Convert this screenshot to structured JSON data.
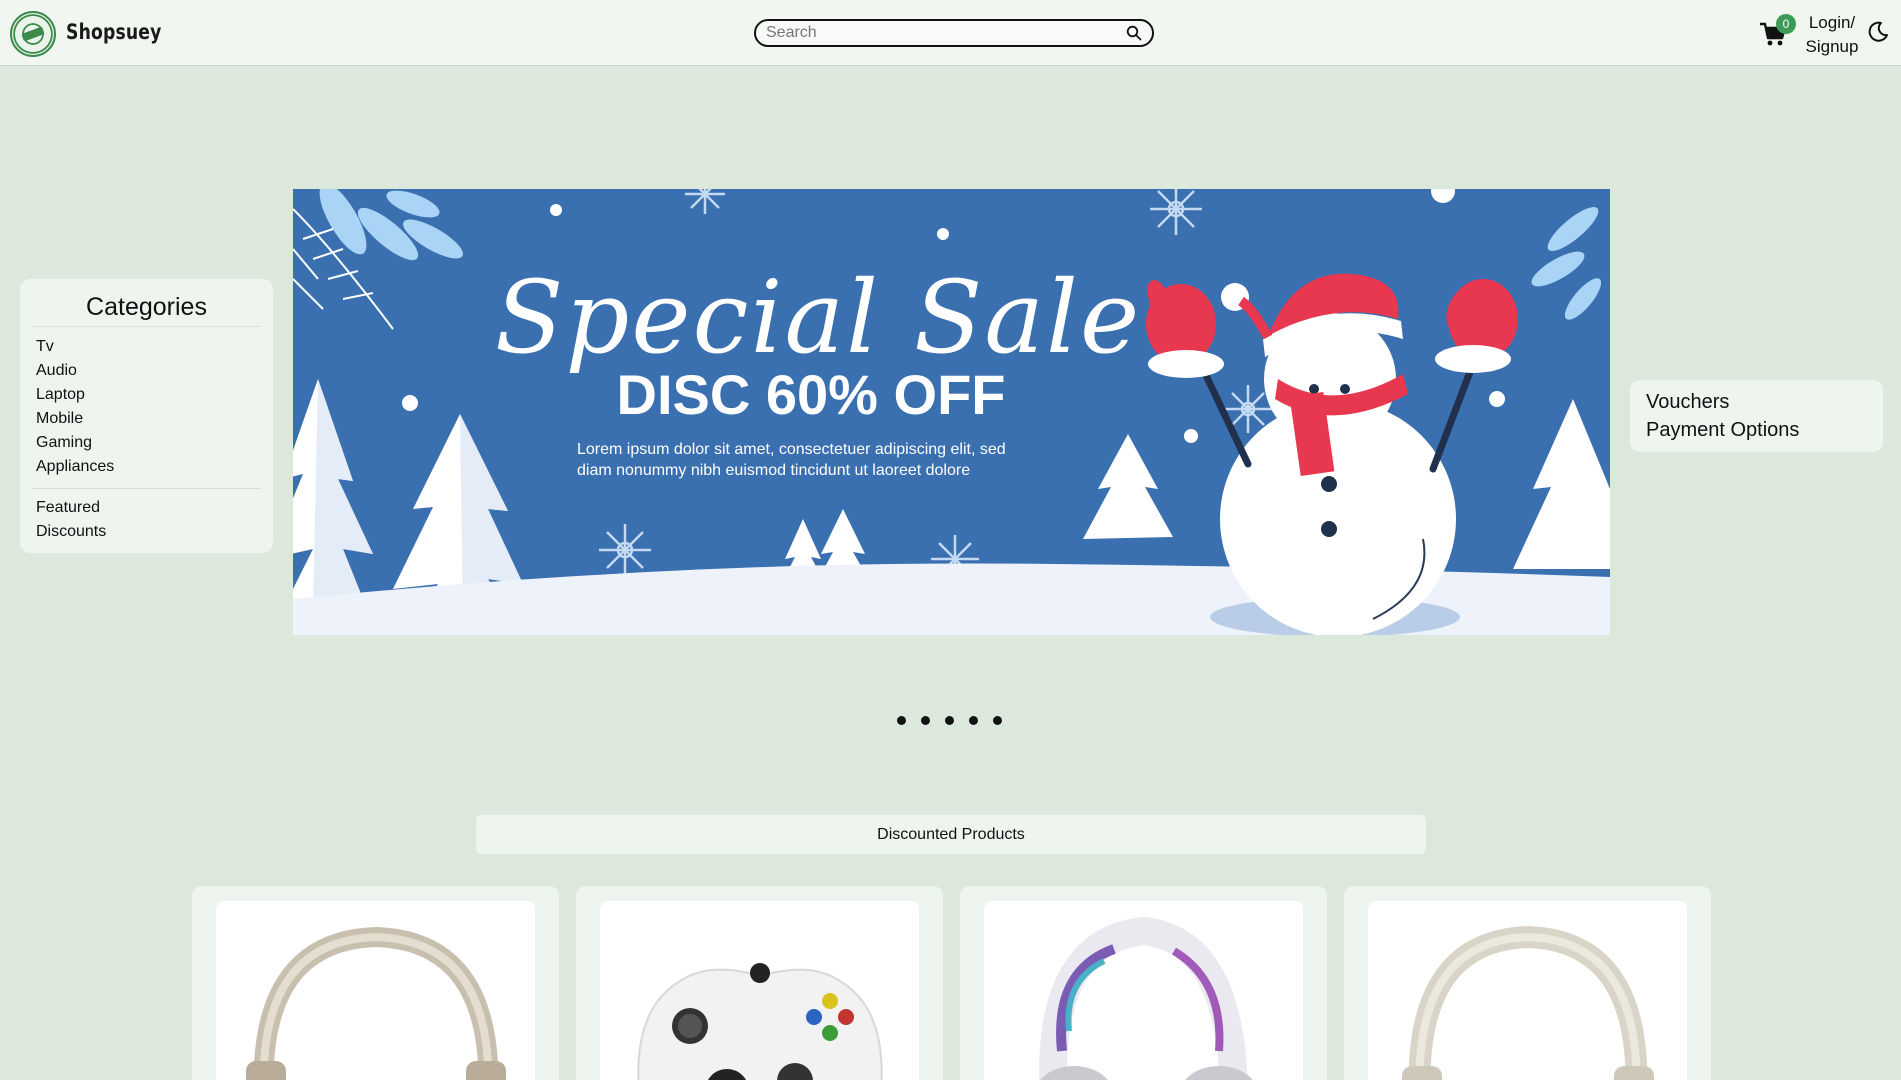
{
  "header": {
    "brand": "Shopsuey",
    "search_placeholder": "Search",
    "cart_count": "0",
    "login_line1": "Login/",
    "login_line2": "Signup"
  },
  "categories": {
    "title": "Categories",
    "group1": [
      "Tv",
      "Audio",
      "Laptop",
      "Mobile",
      "Gaming",
      "Appliances"
    ],
    "group2": [
      "Featured",
      "Discounts"
    ]
  },
  "banner": {
    "title": "Special Sale",
    "subtitle": "DISC 60% OFF",
    "body_line1": "Lorem ipsum dolor sit amet, consectetuer adipiscing elit, sed",
    "body_line2": "diam nonummy nibh euismod tincidunt ut laoreet dolore"
  },
  "side_menu": [
    "Vouchers",
    "Payment Options"
  ],
  "carousel": {
    "slide_count": 5
  },
  "discounted": {
    "title": "Discounted Products",
    "products": [
      {
        "icon": "headphones-beige"
      },
      {
        "icon": "game-controller-white"
      },
      {
        "icon": "gaming-headset-white"
      },
      {
        "icon": "headphones-cream"
      }
    ]
  },
  "colors": {
    "background": "#dce8dc",
    "header_bg": "#f1f6f1",
    "panel_bg": "#eef4ee",
    "banner_blue": "#3a6fb0",
    "badge_green": "#3c9b57"
  }
}
